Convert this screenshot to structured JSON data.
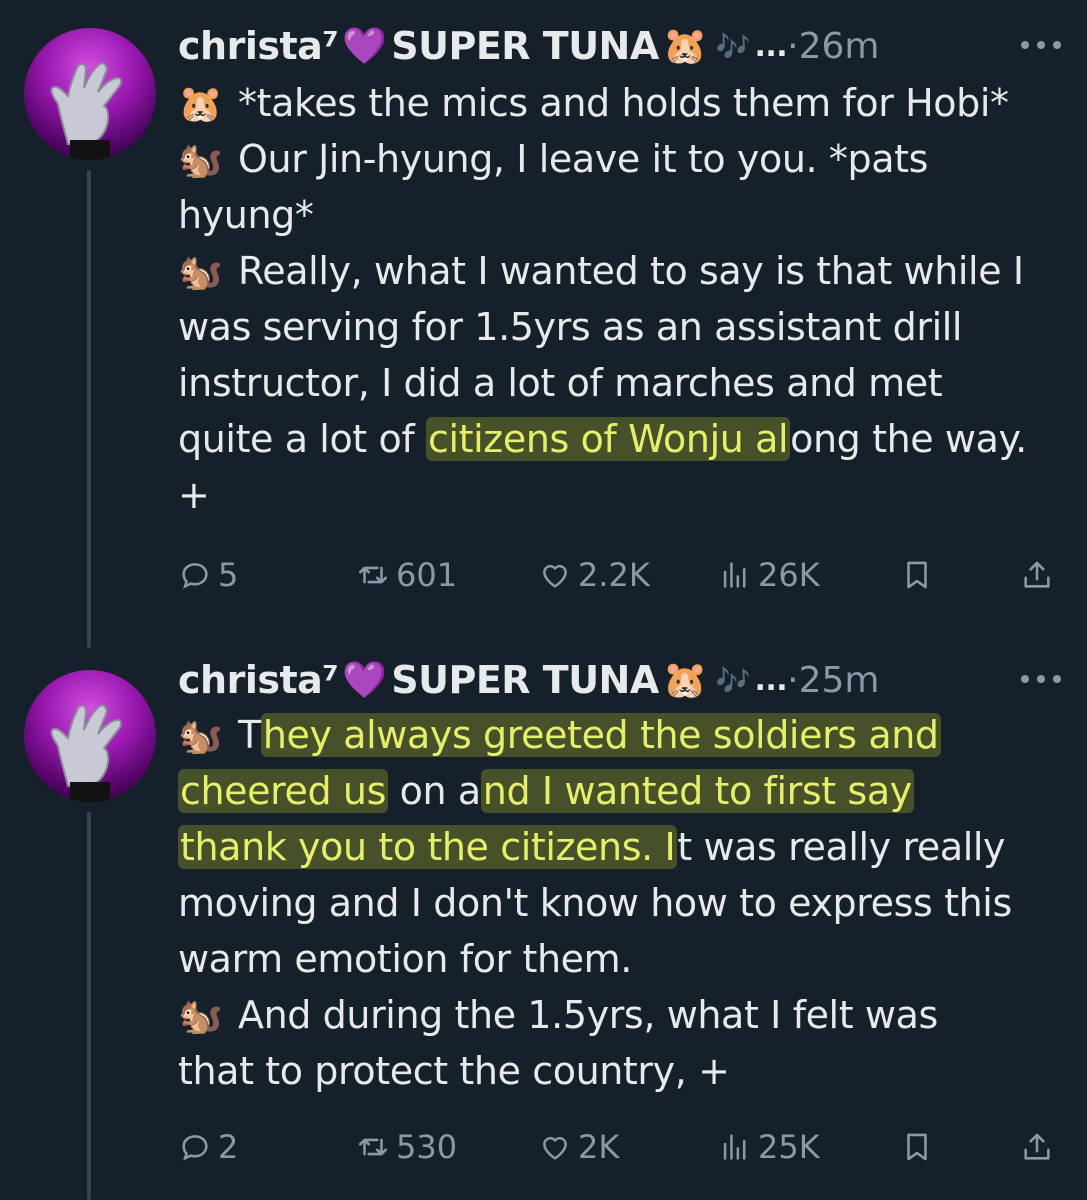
{
  "colors": {
    "background": "#15202b",
    "text": "#e7e9ea",
    "muted": "#8b98a5",
    "highlight_text": "#e6ef6b",
    "avatar_accent": "#b22fc8"
  },
  "icons": {
    "heart": "purple-heart-emoji",
    "hamster": "hamster-emoji",
    "notes": "musical-notes-emoji",
    "chipmunk": "chipmunk-emoji"
  },
  "tweets": [
    {
      "display_name": "christa⁷",
      "name_suffix": "SUPER TUNA",
      "ellipsis": "...",
      "time": "·26m",
      "lines": [
        {
          "emoji": "🐹",
          "text": "*takes the mics and holds them for Hobi*"
        },
        {
          "emoji": "🐿️",
          "text": "Our Jin-hyung, I leave it to you. *pats"
        },
        {
          "text": "hyung*"
        },
        {
          "emoji": "🐿️",
          "text": "Really, what I wanted to say is that while I"
        },
        {
          "text": "was serving for 1.5yrs as an assistant drill"
        },
        {
          "text": "instructor, I did a lot of marches and met"
        },
        {
          "pre": "quite a lot of ",
          "hl": "citizens of Wonju al",
          "post": "ong the way."
        },
        {
          "text": "+"
        }
      ],
      "stats": {
        "replies": "5",
        "retweets": "601",
        "likes": "2.2K",
        "views": "26K"
      }
    },
    {
      "display_name": "christa⁷",
      "name_suffix": "SUPER TUNA",
      "ellipsis": "...",
      "time": "·25m",
      "lines": [
        {
          "emoji": "🐿️",
          "pre": "T",
          "hl": "hey always greeted the soldiers and",
          "post": ""
        },
        {
          "pre": "",
          "hl": "cheered us",
          "mid": " on a",
          "hl2": "nd I wanted to first say",
          "post": ""
        },
        {
          "pre": "",
          "hl": "thank you to the citizens. I",
          "post": "t was really really"
        },
        {
          "text": "moving and I don't know how to express this"
        },
        {
          "text": "warm emotion for them."
        },
        {
          "emoji": "🐿️",
          "text": "And during the 1.5yrs, what I felt was"
        },
        {
          "text": "that to protect the country, +"
        }
      ],
      "stats": {
        "replies": "2",
        "retweets": "530",
        "likes": "2K",
        "views": "25K"
      }
    }
  ]
}
